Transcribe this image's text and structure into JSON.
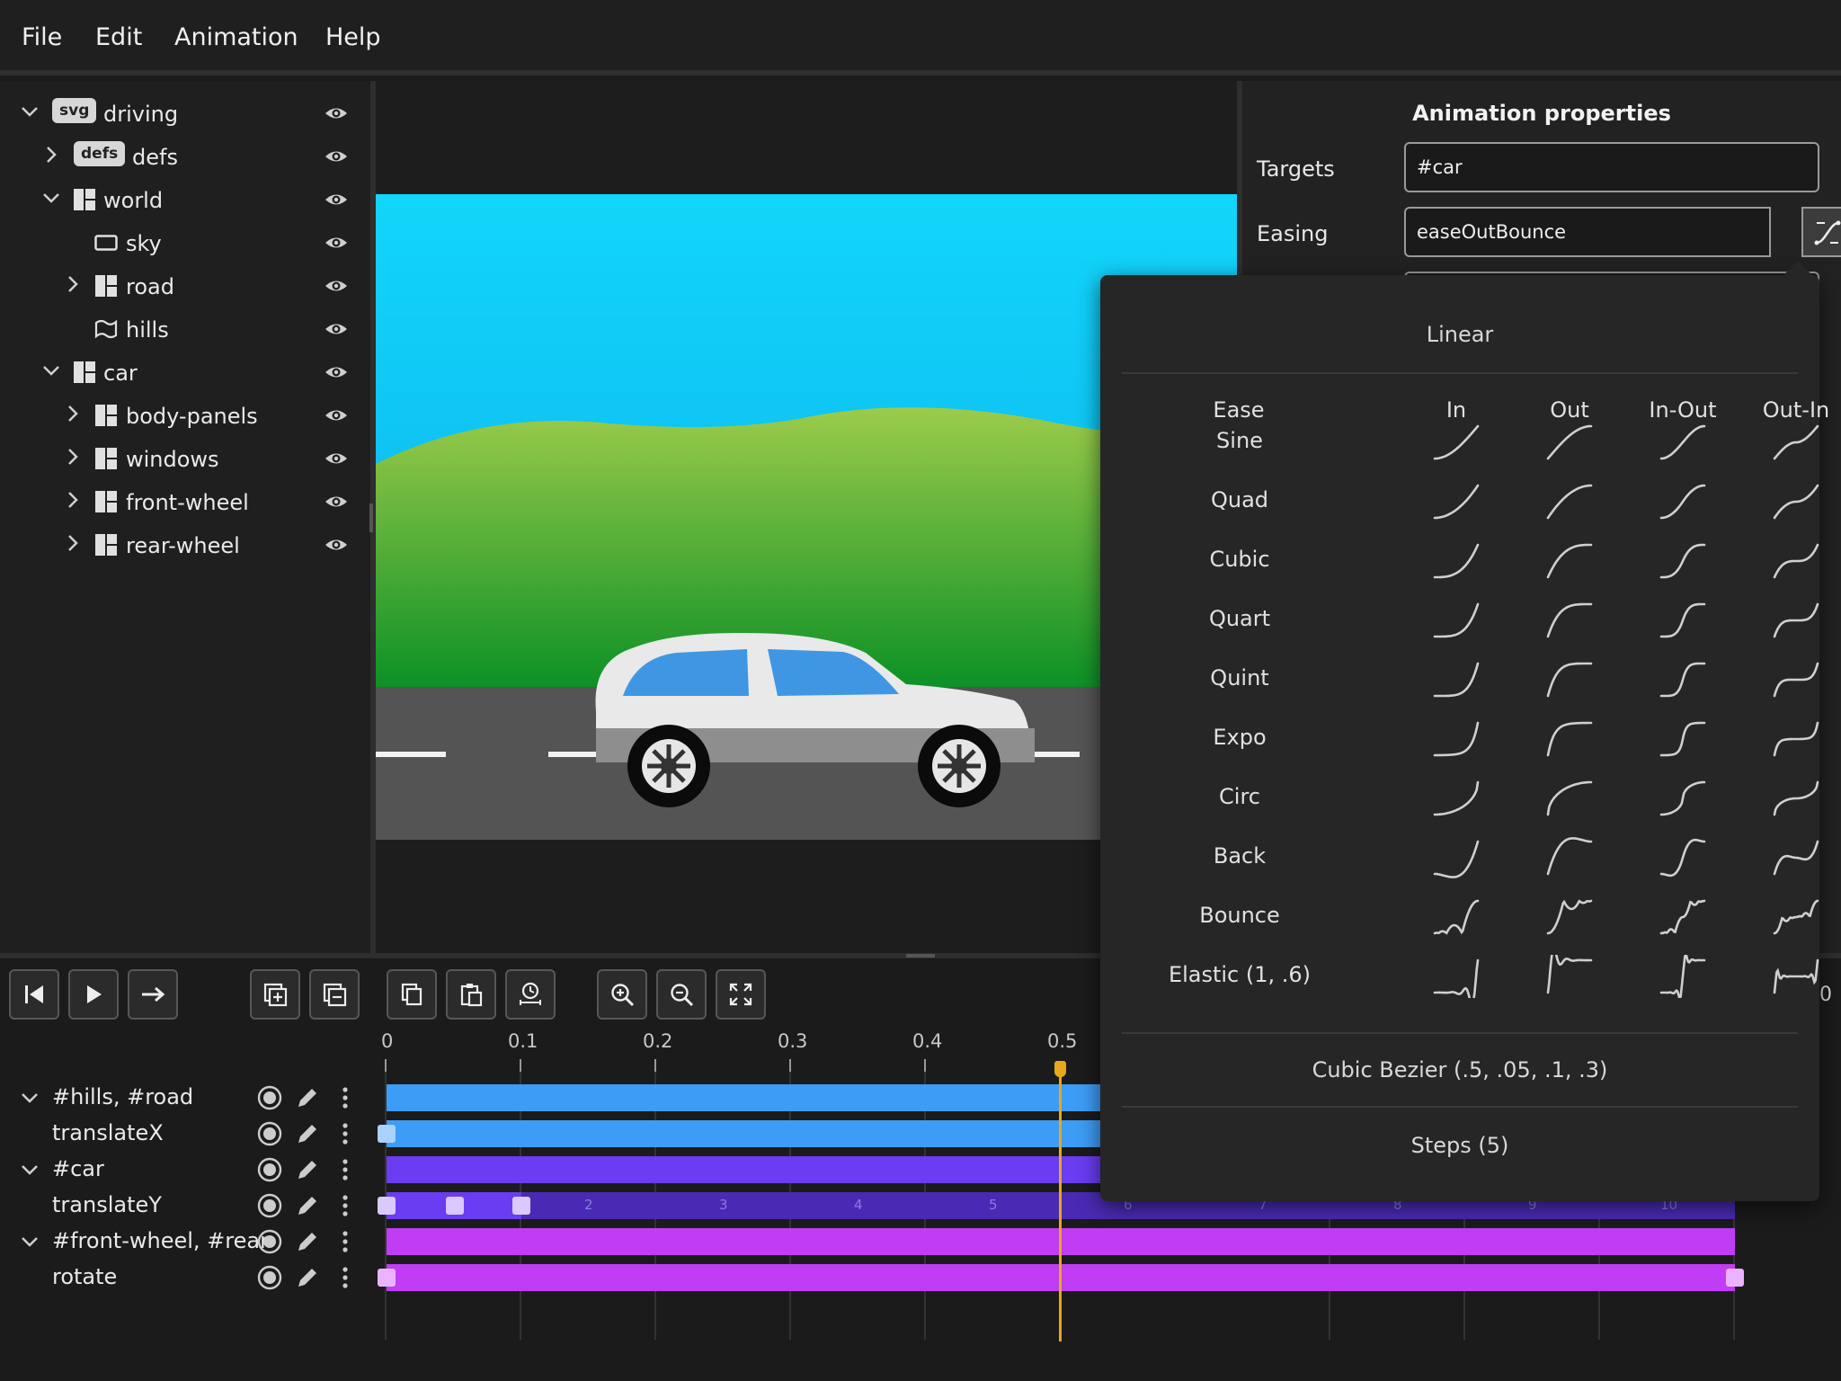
{
  "menu": {
    "items": [
      "File",
      "Edit",
      "Animation",
      "Help"
    ]
  },
  "tree": [
    {
      "label": "driving",
      "icon": "svg-badge",
      "badge": "svg",
      "expanded": true
    },
    {
      "label": "defs",
      "icon": "defs-badge",
      "badge": "defs",
      "expanded": false
    },
    {
      "label": "world",
      "icon": "group-icon",
      "expanded": true
    },
    {
      "label": "sky",
      "icon": "rect-icon"
    },
    {
      "label": "road",
      "icon": "group-icon",
      "expanded": false
    },
    {
      "label": "hills",
      "icon": "path-icon"
    },
    {
      "label": "car",
      "icon": "group-icon",
      "expanded": true
    },
    {
      "label": "body-panels",
      "icon": "group-icon",
      "expanded": false
    },
    {
      "label": "windows",
      "icon": "group-icon",
      "expanded": false
    },
    {
      "label": "front-wheel",
      "icon": "group-icon",
      "expanded": false
    },
    {
      "label": "rear-wheel",
      "icon": "group-icon",
      "expanded": false
    }
  ],
  "properties": {
    "title": "Animation properties",
    "targets_label": "Targets",
    "targets_value": "#car",
    "easing_label": "Easing",
    "easing_value": "easeOutBounce"
  },
  "easing_picker": {
    "linear": "Linear",
    "columns": [
      "Ease",
      "In",
      "Out",
      "In-Out",
      "Out-In"
    ],
    "rows": [
      "Sine",
      "Quad",
      "Cubic",
      "Quart",
      "Quint",
      "Expo",
      "Circ",
      "Back",
      "Bounce",
      "Elastic (1, .6)"
    ],
    "cubic_bezier": "Cubic Bezier (.5, .05, .1, .3)",
    "steps": "Steps (5)"
  },
  "toolbar": {
    "buttons": [
      "skip-to-start-icon",
      "play-icon",
      "arrow-right-icon",
      "add-track-icon",
      "remove-track-icon",
      "copy-icon",
      "paste-icon",
      "time-icon",
      "zoom-in-icon",
      "zoom-out-icon",
      "fit-icon"
    ],
    "partial_readout": "0"
  },
  "timeline": {
    "ticks": [
      "0",
      "0.1",
      "0.2",
      "0.3",
      "0.4",
      "0.5"
    ],
    "playhead": "0.5",
    "sub_numbers": [
      "2",
      "3",
      "4",
      "5",
      "6",
      "7",
      "8",
      "9",
      "10"
    ],
    "tracks": [
      {
        "label": "#hills, #road",
        "color": "#3d9cf5",
        "group": true
      },
      {
        "label": "translateX",
        "color": "#3d9cf5",
        "group": false
      },
      {
        "label": "#car",
        "color": "#6a3cf2",
        "group": true
      },
      {
        "label": "translateY",
        "color": "#5a2fd6",
        "group": false
      },
      {
        "label": "#front-wheel, #rear-",
        "color": "#c13cf5",
        "group": true
      },
      {
        "label": "rotate",
        "color": "#c13cf5",
        "group": false
      }
    ]
  },
  "colors": {
    "sky_top": "#12d6fb",
    "sky_bottom": "#0aaee8",
    "hill_light": "#8fc74a",
    "hill_dark": "#0f9426",
    "road": "#555555",
    "car_body": "#e6e6e6",
    "car_window": "#3f97e3",
    "playhead": "#e7a81a"
  }
}
